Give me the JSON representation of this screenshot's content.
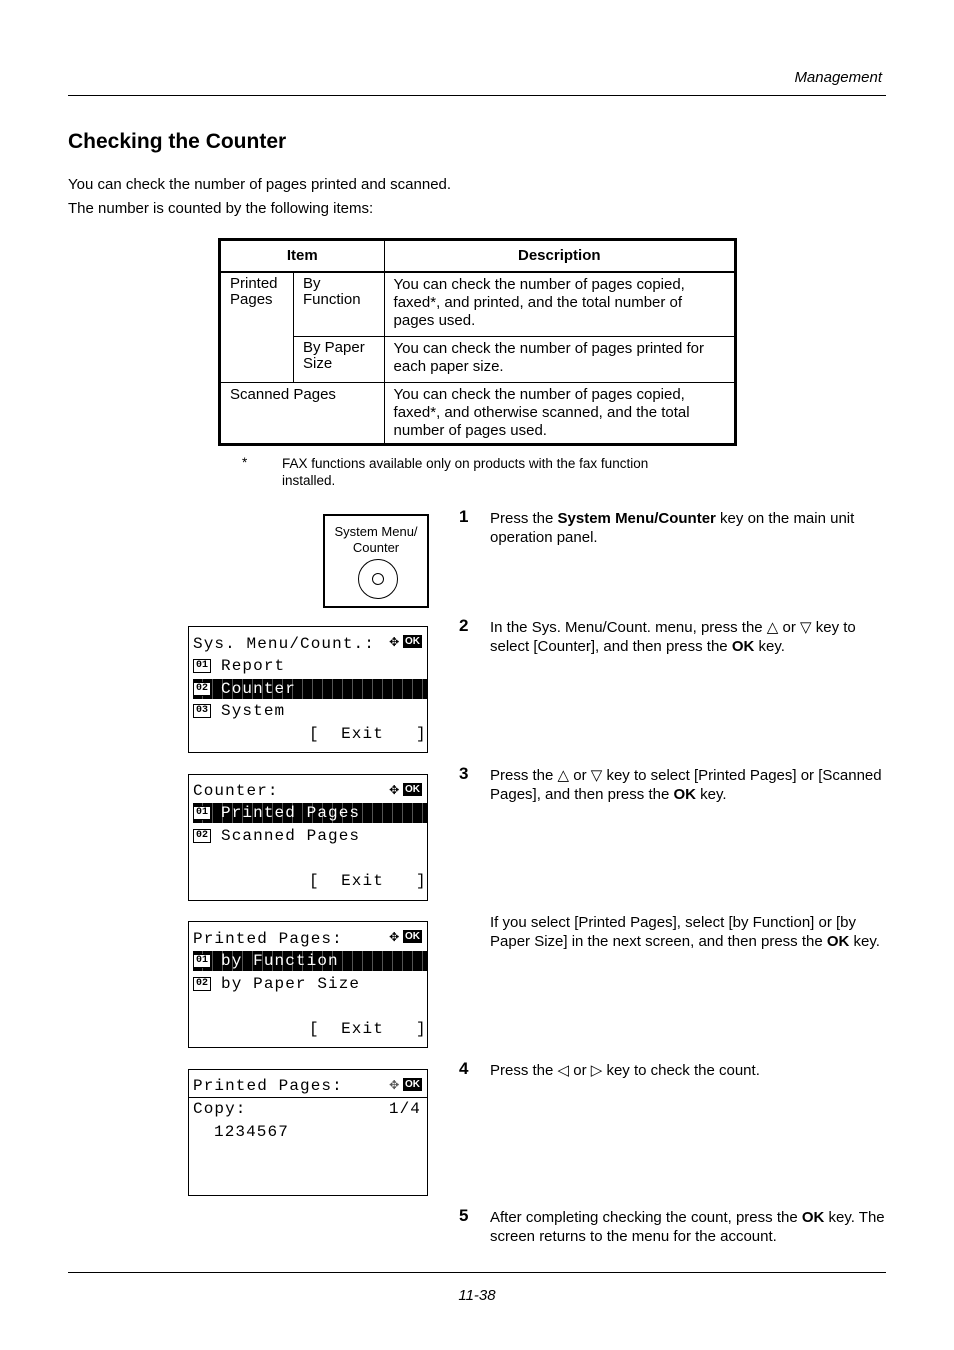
{
  "header": {
    "section": "Management"
  },
  "title": "Checking the Counter",
  "intro": [
    "You can check the number of pages printed and scanned.",
    "The number is counted by the following items:"
  ],
  "table": {
    "headers": [
      "Item",
      "Description"
    ],
    "rows": [
      {
        "group": "Printed Pages",
        "item": "By Function",
        "desc": "You can check the number of pages copied, faxed*, and printed, and the total number of pages used."
      },
      {
        "item": "By Paper Size",
        "desc": "You can check the number of pages printed for each paper size."
      },
      {
        "group": "Scanned Pages",
        "desc": "You can check the number of pages copied, faxed*, and otherwise scanned, and the total number of pages used."
      }
    ]
  },
  "footnote": {
    "mark": "*",
    "text": "FAX functions available only on products with the fax function installed."
  },
  "key": {
    "label1": "System Menu/",
    "label2": "Counter"
  },
  "screens": [
    {
      "title": "Sys. Menu/Count.:",
      "items": [
        {
          "n": "01",
          "t": "Report"
        },
        {
          "n": "02",
          "t": "Counter"
        },
        {
          "n": "03",
          "t": "System"
        }
      ],
      "exit": "[  Exit   ]"
    },
    {
      "title": "Counter:",
      "items": [
        {
          "n": "01",
          "t": "Printed Pages"
        },
        {
          "n": "02",
          "t": "Scanned Pages"
        }
      ],
      "exit": "[  Exit   ]"
    },
    {
      "title": "Printed Pages:",
      "items": [
        {
          "n": "01",
          "t": "by Function"
        },
        {
          "n": "02",
          "t": "by Paper Size"
        }
      ],
      "exit": "[  Exit   ]"
    },
    {
      "title": "Printed Pages:",
      "label": "Copy:",
      "page": "1/4",
      "value": "1234567"
    }
  ],
  "ok": "OK",
  "steps": [
    {
      "n": "1",
      "a": "Press the ",
      "b": "System Menu/Counter",
      "c": " key on the main unit operation panel."
    },
    {
      "n": "2",
      "a": "In the Sys. Menu/Count. menu, press the △ or ▽ key to select [Counter], and then press the ",
      "b": "OK",
      "c": " key."
    },
    {
      "n": "3",
      "a": "Press the △ or ▽ key to select [Printed Pages] or [Scanned Pages], and then press the ",
      "b": "OK",
      "c": " key."
    },
    {
      "a": "If you select [Printed Pages], select [by Function] or [by Paper Size] in the next screen, and then press the ",
      "b": "OK",
      "c": " key."
    },
    {
      "n": "4",
      "a": "Press the ◁ or ▷ key to check the count."
    },
    {
      "n": "5",
      "a": "After completing checking the count, press the ",
      "b": "OK",
      "c": " key. The screen returns to the menu for the account."
    }
  ],
  "footer": {
    "page": "11-38"
  }
}
